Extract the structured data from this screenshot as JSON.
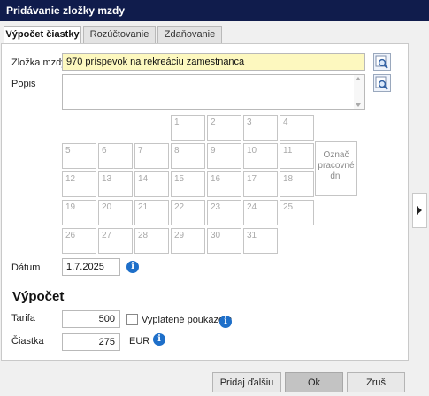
{
  "window": {
    "title": "Pridávanie zložky mzdy"
  },
  "tabs": [
    {
      "label": "Výpočet čiastky",
      "active": true
    },
    {
      "label": "Rozúčtovanie",
      "active": false
    },
    {
      "label": "Zdaňovanie",
      "active": false
    }
  ],
  "form": {
    "component_label": "Zložka mzdy",
    "component_value": "970  príspevok na rekreáciu zamestnanca",
    "description_label": "Popis",
    "description_value": "",
    "date_label": "Dátum",
    "date_value": "1.7.2025"
  },
  "calendar": {
    "days": [
      "1",
      "2",
      "3",
      "4",
      "5",
      "6",
      "7",
      "8",
      "9",
      "10",
      "11",
      "12",
      "13",
      "14",
      "15",
      "16",
      "17",
      "18",
      "19",
      "20",
      "21",
      "22",
      "23",
      "24",
      "25",
      "26",
      "27",
      "28",
      "29",
      "30",
      "31"
    ],
    "mark_workdays_label": "Označ pracovné dni"
  },
  "calculation": {
    "title": "Výpočet",
    "rate_label": "Tarifa",
    "rate_value": "500",
    "voucher_label": "Vyplatené poukazom",
    "voucher_checked": false,
    "amount_label": "Čiastka",
    "amount_value": "275",
    "currency": "EUR"
  },
  "buttons": {
    "add_next": "Pridaj ďalšiu",
    "ok": "Ok",
    "cancel": "Zruš"
  },
  "icons": {
    "lookup": "magnifier-icon",
    "info": "info-icon",
    "side": "chevron-right-icon",
    "info_glyph": "i"
  },
  "colors": {
    "titlebar": "#101c4c",
    "yellow_field": "#fdf8bf",
    "info_blue": "#1e6fc9"
  }
}
